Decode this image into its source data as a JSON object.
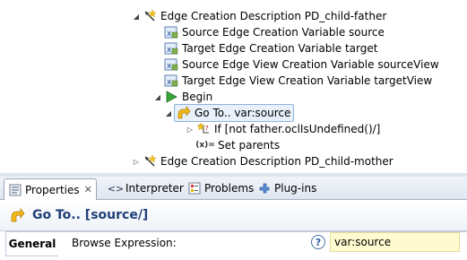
{
  "tree": {
    "rows": [
      {
        "label": "Edge Creation Description PD_child-father",
        "icon": "edge-creation-icon",
        "expanded": true
      },
      {
        "label": "Source Edge Creation Variable source",
        "icon": "variable-icon"
      },
      {
        "label": "Target Edge Creation Variable target",
        "icon": "variable-icon"
      },
      {
        "label": "Source Edge View Creation Variable sourceView",
        "icon": "variable-icon"
      },
      {
        "label": "Target Edge View Creation Variable targetView",
        "icon": "variable-icon"
      },
      {
        "label": "Begin",
        "icon": "play-icon",
        "expanded": true
      },
      {
        "label": "Go To..  var:source",
        "icon": "goto-icon",
        "expanded": true,
        "selected": true
      },
      {
        "label": "If [not father.oclIsUndefined()/]",
        "icon": "if-icon",
        "expanded": false
      },
      {
        "label": "Set  parents",
        "icon": "set-icon",
        "icon_text": "(x)="
      },
      {
        "label": "Edge Creation Description PD_child-mother",
        "icon": "edge-creation-icon",
        "expanded": false
      }
    ]
  },
  "tabs": [
    {
      "label": "Properties",
      "icon": "properties-icon",
      "active": true,
      "close": "✕"
    },
    {
      "label": "Interpreter",
      "icon": "interpreter-icon"
    },
    {
      "label": "Problems",
      "icon": "problems-icon"
    },
    {
      "label": "Plug-ins",
      "icon": "plugins-icon"
    }
  ],
  "properties": {
    "title": "Go To..  [source/]",
    "section_tab": "General",
    "field_label": "Browse Expression:",
    "field_value": "var:source",
    "help_glyph": "?"
  },
  "colors": {
    "title": "#1f3f7a",
    "selection_bg": "#e8f1fb",
    "input_bg": "#fffbd0"
  }
}
